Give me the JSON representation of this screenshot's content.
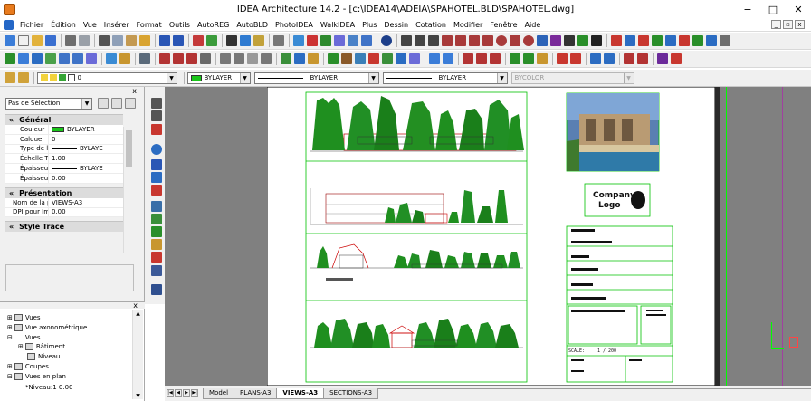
{
  "window": {
    "title": "IDEA Architecture 14.2  - [c:\\IDEA14\\ADEIA\\SPAHOTEL.BLD\\SPAHOTEL.dwg]",
    "min": "−",
    "max": "□",
    "close": "✕"
  },
  "menu": [
    "Fichier",
    "Édition",
    "Vue",
    "Insérer",
    "Format",
    "Outils",
    "AutoREG",
    "AutoBLD",
    "PhotoIDEA",
    "WalkIDEA",
    "Plus",
    "Dessin",
    "Cotation",
    "Modifier",
    "Fenêtre",
    "Aide"
  ],
  "mdi_controls": [
    "_",
    "▫",
    "x"
  ],
  "propbar": {
    "layer": "0",
    "color": "BYLAYER",
    "linetype": "BYLAYER",
    "lineweight": "BYLAYER",
    "plotstyle": "BYCOLOR"
  },
  "properties": {
    "close": "x",
    "selection": "Pas de Sélection",
    "sections": [
      {
        "title": "Général",
        "rows": [
          {
            "k": "Couleur",
            "v": "BYLAYER"
          },
          {
            "k": "Calque",
            "v": "0"
          },
          {
            "k": "Type de ligne",
            "v": "BYLAYE"
          },
          {
            "k": "Échelle Typ...",
            "v": "1.00"
          },
          {
            "k": "Épaisseur ligne",
            "v": "BYLAYE"
          },
          {
            "k": "Épaisseur",
            "v": "0.00"
          }
        ]
      },
      {
        "title": "Présentation",
        "rows": [
          {
            "k": "Nom de la p...",
            "v": "VIEWS-A3"
          },
          {
            "k": "DPI pour Im...",
            "v": "0.00"
          }
        ]
      },
      {
        "title": "Style Trace",
        "rows": []
      }
    ]
  },
  "tree": {
    "close": "x",
    "items": [
      "Vues",
      "Vue axonométrique",
      "Vues",
      "Bâtiment",
      "Niveau",
      "Coupes",
      "Vues en plan",
      "*Niveau:1 0.00"
    ]
  },
  "tabs": [
    "Model",
    "PLANS-A3",
    "VIEWS-A3",
    "SECTIONS-A3"
  ],
  "active_tab": "VIEWS-A3",
  "sheet": {
    "logo_line1": "Company",
    "logo_line2": "Logo",
    "scale_label": "SCALE:",
    "scale_value": "1 / 200"
  },
  "colors": {
    "sheet_frame": "#00c000",
    "trees": "#1f8f1f",
    "building": "#c00000",
    "background": "#808080"
  }
}
